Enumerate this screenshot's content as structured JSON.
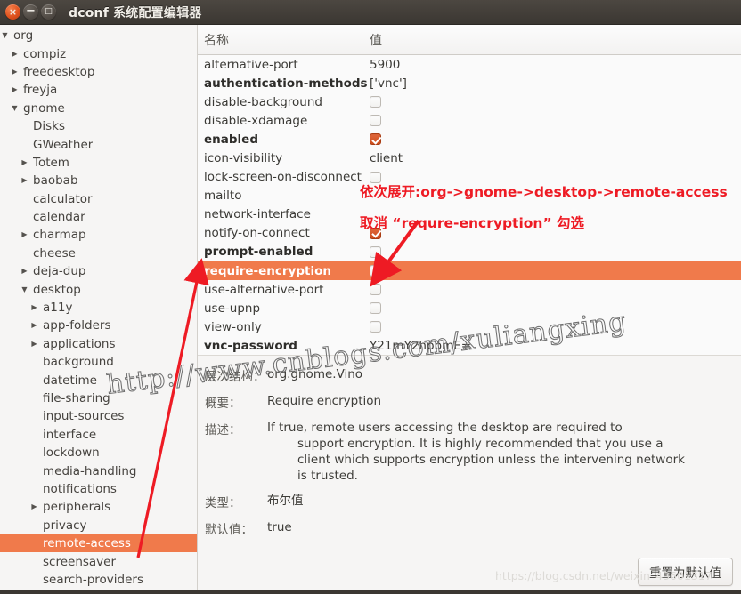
{
  "window": {
    "title": "dconf 系统配置编辑器",
    "close_icon": "window-close-icon",
    "minimize_icon": "window-minimize-icon",
    "maximize_icon": "window-maximize-icon"
  },
  "sidebar": {
    "items": [
      {
        "label": "org",
        "indent": 0,
        "arrow": "down"
      },
      {
        "label": "compiz",
        "indent": 1,
        "arrow": "right"
      },
      {
        "label": "freedesktop",
        "indent": 1,
        "arrow": "right"
      },
      {
        "label": "freyja",
        "indent": 1,
        "arrow": "right"
      },
      {
        "label": "gnome",
        "indent": 1,
        "arrow": "down"
      },
      {
        "label": "Disks",
        "indent": 2,
        "arrow": "none"
      },
      {
        "label": "GWeather",
        "indent": 2,
        "arrow": "none"
      },
      {
        "label": "Totem",
        "indent": 2,
        "arrow": "right"
      },
      {
        "label": "baobab",
        "indent": 2,
        "arrow": "right"
      },
      {
        "label": "calculator",
        "indent": 2,
        "arrow": "none"
      },
      {
        "label": "calendar",
        "indent": 2,
        "arrow": "none"
      },
      {
        "label": "charmap",
        "indent": 2,
        "arrow": "right"
      },
      {
        "label": "cheese",
        "indent": 2,
        "arrow": "none"
      },
      {
        "label": "deja-dup",
        "indent": 2,
        "arrow": "right"
      },
      {
        "label": "desktop",
        "indent": 2,
        "arrow": "down"
      },
      {
        "label": "a11y",
        "indent": 3,
        "arrow": "right"
      },
      {
        "label": "app-folders",
        "indent": 3,
        "arrow": "right"
      },
      {
        "label": "applications",
        "indent": 3,
        "arrow": "right"
      },
      {
        "label": "background",
        "indent": 3,
        "arrow": "none"
      },
      {
        "label": "datetime",
        "indent": 3,
        "arrow": "none"
      },
      {
        "label": "file-sharing",
        "indent": 3,
        "arrow": "none"
      },
      {
        "label": "input-sources",
        "indent": 3,
        "arrow": "none"
      },
      {
        "label": "interface",
        "indent": 3,
        "arrow": "none"
      },
      {
        "label": "lockdown",
        "indent": 3,
        "arrow": "none"
      },
      {
        "label": "media-handling",
        "indent": 3,
        "arrow": "none"
      },
      {
        "label": "notifications",
        "indent": 3,
        "arrow": "none"
      },
      {
        "label": "peripherals",
        "indent": 3,
        "arrow": "right"
      },
      {
        "label": "privacy",
        "indent": 3,
        "arrow": "none"
      },
      {
        "label": "remote-access",
        "indent": 3,
        "arrow": "none",
        "selected": true
      },
      {
        "label": "screensaver",
        "indent": 3,
        "arrow": "none"
      },
      {
        "label": "search-providers",
        "indent": 3,
        "arrow": "none"
      }
    ]
  },
  "keytable": {
    "columns": {
      "name": "名称",
      "value": "值"
    },
    "rows": [
      {
        "name": "alternative-port",
        "bold": false,
        "type": "text",
        "value": "5900"
      },
      {
        "name": "authentication-methods",
        "bold": true,
        "type": "text",
        "value": "['vnc']"
      },
      {
        "name": "disable-background",
        "bold": false,
        "type": "checkbox",
        "checked": false
      },
      {
        "name": "disable-xdamage",
        "bold": false,
        "type": "checkbox",
        "checked": false
      },
      {
        "name": "enabled",
        "bold": true,
        "type": "checkbox",
        "checked": true
      },
      {
        "name": "icon-visibility",
        "bold": false,
        "type": "text",
        "value": "client"
      },
      {
        "name": "lock-screen-on-disconnect",
        "bold": false,
        "type": "checkbox",
        "checked": false
      },
      {
        "name": "mailto",
        "bold": false,
        "type": "text",
        "value": ""
      },
      {
        "name": "network-interface",
        "bold": false,
        "type": "text",
        "value": ""
      },
      {
        "name": "notify-on-connect",
        "bold": false,
        "type": "checkbox",
        "checked": true
      },
      {
        "name": "prompt-enabled",
        "bold": true,
        "type": "checkbox",
        "checked": false
      },
      {
        "name": "require-encryption",
        "bold": true,
        "type": "checkbox",
        "checked": false,
        "selected": true
      },
      {
        "name": "use-alternative-port",
        "bold": false,
        "type": "checkbox",
        "checked": false
      },
      {
        "name": "use-upnp",
        "bold": false,
        "type": "checkbox",
        "checked": false
      },
      {
        "name": "view-only",
        "bold": false,
        "type": "checkbox",
        "checked": false
      },
      {
        "name": "vnc-password",
        "bold": true,
        "type": "text",
        "value": "Y21mY2hpbmE="
      }
    ]
  },
  "detail": {
    "schema_label": "层次结构：",
    "schema_value": "org.gnome.Vino",
    "summary_label": "概要：",
    "summary_value": "Require encryption",
    "description_label": "描述：",
    "description_line1": "If true, remote users accessing the desktop are required to",
    "description_line2": "support encryption. It is highly recommended that you use a",
    "description_line3": "client which supports encryption unless the intervening network",
    "description_line4": "is trusted.",
    "type_label": "类型：",
    "type_value": "布尔值",
    "default_label": "默认值：",
    "default_value": "true",
    "reset_button": "重置为默认值"
  },
  "annotations": {
    "line1": "依次展开:org->gnome->desktop->remote-access",
    "line2": "取消 “requre-encryption” 勾选",
    "arrow_icon": "red-arrow-icon"
  },
  "watermarks": {
    "cnblogs": "http://www.cnblogs.com/xuliangxing",
    "csdn": "https://blog.csdn.net/weixin_43601317"
  },
  "colors": {
    "selection": "#f07a4b",
    "checkbox_on": "#d4551f",
    "annotation": "#ee1b24",
    "titlebar": "#3b3732"
  }
}
